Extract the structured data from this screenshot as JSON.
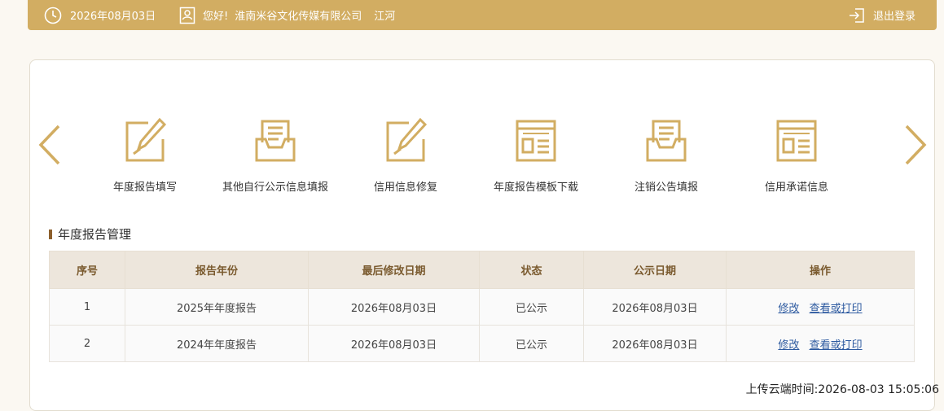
{
  "topbar": {
    "date": "2026年08月03日",
    "greeting": "您好!",
    "company": "淮南米谷文化传媒有限公司",
    "user": "江河",
    "logout": "退出登录"
  },
  "nav": {
    "items": [
      {
        "label": "年度报告填写",
        "icon": "edit-icon"
      },
      {
        "label": "其他自行公示信息填报",
        "icon": "inbox-icon"
      },
      {
        "label": "信用信息修复",
        "icon": "edit-icon"
      },
      {
        "label": "年度报告模板下载",
        "icon": "template-icon"
      },
      {
        "label": "注销公告填报",
        "icon": "inbox-icon"
      },
      {
        "label": "信用承诺信息",
        "icon": "template-icon"
      }
    ]
  },
  "section": {
    "title": "年度报告管理"
  },
  "table": {
    "headers": [
      "序号",
      "报告年份",
      "最后修改日期",
      "状态",
      "公示日期",
      "操作"
    ],
    "rows": [
      {
        "no": "1",
        "year": "2025年年度报告",
        "modified": "2026年08月03日",
        "status": "已公示",
        "published": "2026年08月03日",
        "edit": "修改",
        "view": "查看或打印"
      },
      {
        "no": "2",
        "year": "2024年年度报告",
        "modified": "2026年08月03日",
        "status": "已公示",
        "published": "2026年08月03日",
        "edit": "修改",
        "view": "查看或打印"
      }
    ]
  },
  "footer": {
    "upload_time": "上传云端时间:2026-08-03 15:05:06"
  },
  "colors": {
    "accent": "#d2ad62",
    "header_text": "#7a5a2e",
    "link": "#2d5aa0"
  }
}
